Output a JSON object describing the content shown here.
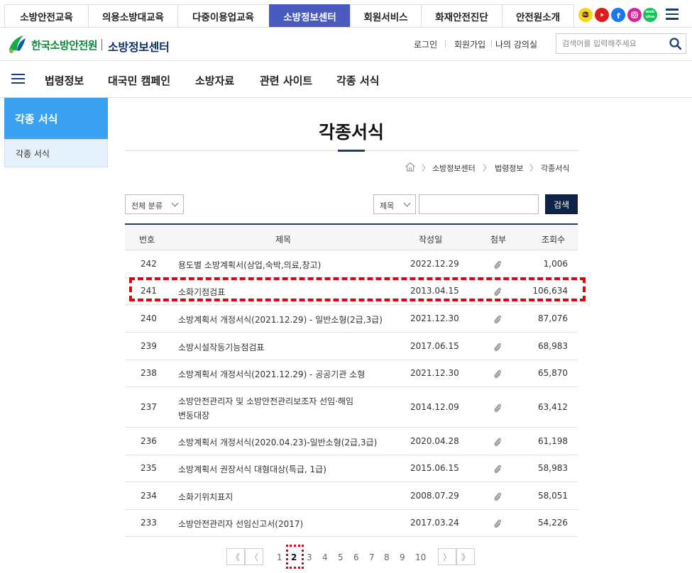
{
  "topnav": {
    "tabs": [
      {
        "label": "소방안전교육"
      },
      {
        "label": "의용소방대교육"
      },
      {
        "label": "다중이용업교육"
      },
      {
        "label": "소방정보센터"
      },
      {
        "label": "회원서비스"
      },
      {
        "label": "화재안전진단"
      },
      {
        "label": "안전원소개"
      }
    ],
    "active_tab": "소방정보센터",
    "sns_icons": [
      "kakaotalk-icon",
      "youtube-icon",
      "facebook-icon",
      "instagram-icon",
      "webzine-icon"
    ],
    "sns_label_webzine": "web zine"
  },
  "header": {
    "org_name": "한국소방안전원",
    "site_name": "소방정보센터",
    "util_links": [
      "로그인",
      "회원가입",
      "나의 강의실"
    ],
    "search_placeholder": "검색어를 입력해주세요"
  },
  "gnb": {
    "items": [
      "법령정보",
      "대국민 캠페인",
      "소방자료",
      "관련 사이트",
      "각종 서식"
    ]
  },
  "lnb": {
    "title": "각종 서식",
    "items": [
      "각종 서식"
    ]
  },
  "page": {
    "title": "각종서식",
    "breadcrumb": [
      "소방정보센터",
      "법령정보",
      "각종서식"
    ]
  },
  "filter": {
    "category": "전체 분류",
    "field": "제목",
    "keyword": "",
    "search_label": "검색"
  },
  "table": {
    "headers": [
      "번호",
      "제목",
      "작성일",
      "첨부",
      "조회수"
    ],
    "rows": [
      {
        "no": "242",
        "title": "용도별 소방계획서(상업,숙박,의료,창고)",
        "date": "2022.12.29",
        "views": "1,006"
      },
      {
        "no": "241",
        "title": "소화기점검표",
        "date": "2013.04.15",
        "views": "106,634"
      },
      {
        "no": "240",
        "title": "소방계획서 개정서식(2021.12.29) - 일반소형(2급,3급)",
        "date": "2021.12.30",
        "views": "87,076"
      },
      {
        "no": "239",
        "title": "소방시설작동기능점검표",
        "date": "2017.06.15",
        "views": "68,983"
      },
      {
        "no": "238",
        "title": "소방계획서 개정서식(2021.12.29) - 공공기관 소형",
        "date": "2021.12.30",
        "views": "65,870"
      },
      {
        "no": "237",
        "title": "소방안전관리자 및 소방안전관리보조자 선임·해임",
        "title2": "변동대장",
        "date": "2014.12.09",
        "views": "63,412"
      },
      {
        "no": "236",
        "title": "소방계획서 개정서식(2020.04.23)-일반소형(2급,3급)",
        "date": "2020.04.28",
        "views": "61,198"
      },
      {
        "no": "235",
        "title": "소방계획서 권장서식 대형대상(특급, 1급)",
        "date": "2015.06.15",
        "views": "58,983"
      },
      {
        "no": "234",
        "title": "소화기위치표지",
        "date": "2008.07.29",
        "views": "58,051"
      },
      {
        "no": "233",
        "title": "소방안전관리자 선임신고서(2017)",
        "date": "2017.03.24",
        "views": "54,226"
      }
    ]
  },
  "pagination": {
    "first": "《",
    "prev": "〈",
    "pages": [
      "1",
      "2",
      "3",
      "4",
      "5",
      "6",
      "7",
      "8",
      "9",
      "10"
    ],
    "current": "2",
    "next": "〉",
    "last": "》"
  }
}
